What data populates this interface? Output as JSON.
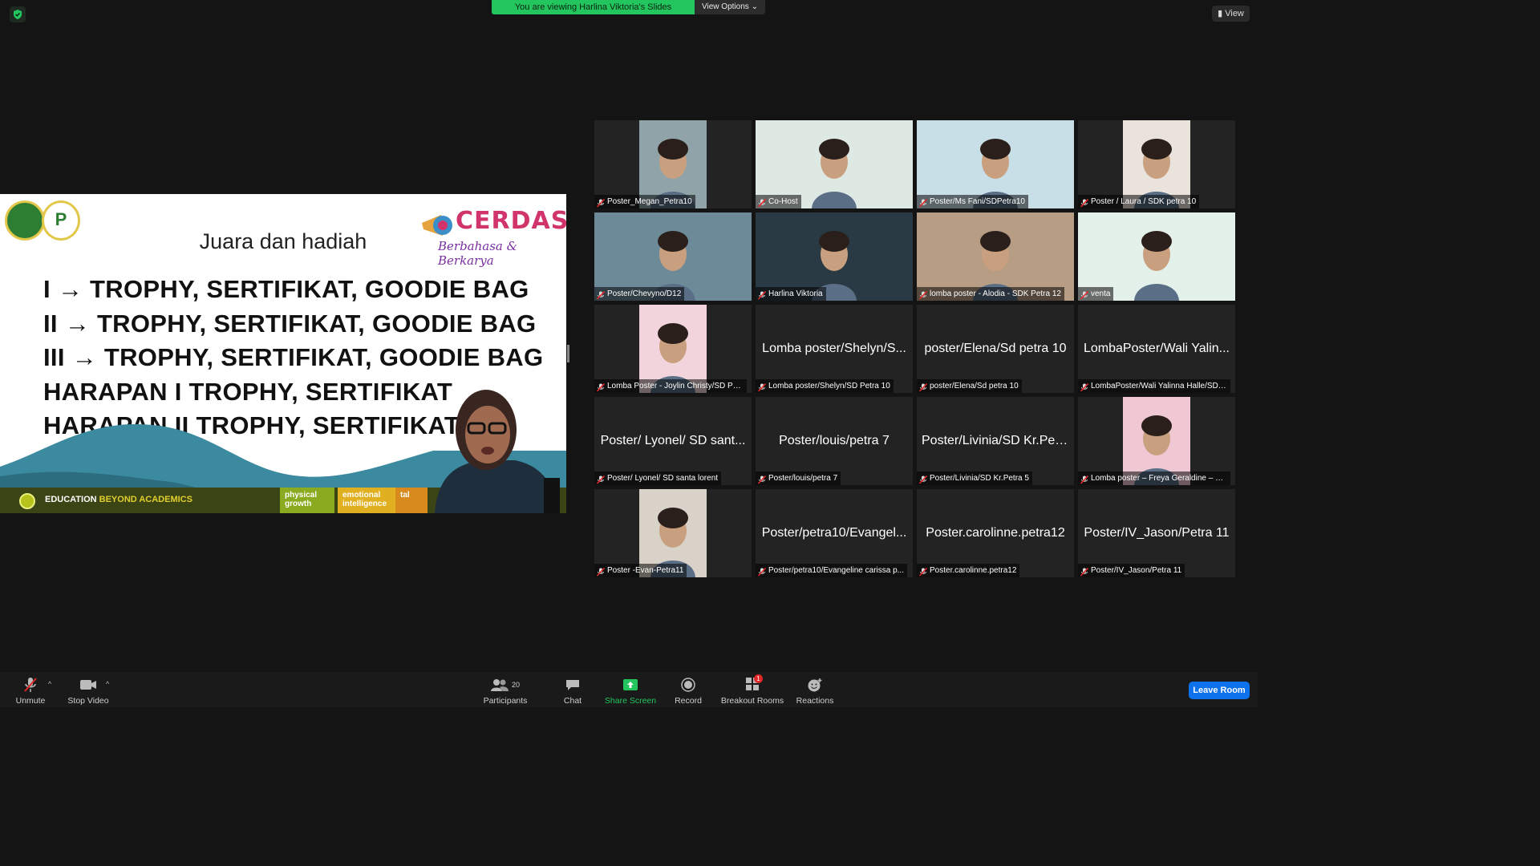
{
  "top": {
    "banner": "You are viewing Harlina Viktoria's Slides",
    "view_options": "View Options",
    "view_label": "View"
  },
  "slide": {
    "brand_title": "CERDAS",
    "brand_subtitle": "Berbahasa & Berkarya",
    "logo_b_text": "P",
    "heading": "Juara dan hadiah",
    "lines": [
      "I → TROPHY, SERTIFIKAT, GOODIE BAG",
      "II → TROPHY, SERTIFIKAT, GOODIE BAG",
      "III → TROPHY, SERTIFIKAT, GOODIE BAG",
      "HARAPAN I TROPHY, SERTIFIKAT",
      "HARAPAN II TROPHY, SERTIFIKAT"
    ],
    "footer_text": "EDUCATION",
    "footer_highlight": "BEYOND ACADEMICS",
    "chips": [
      "physical growth",
      "emotional intelligence",
      "tal"
    ]
  },
  "participants": [
    {
      "name": "Poster_Megan_Petra10",
      "big": "",
      "type": "video",
      "color": "#8fa3a8"
    },
    {
      "name": "Co-Host",
      "big": "",
      "type": "video",
      "color": "#dfe9e4"
    },
    {
      "name": "Poster/Ms Fani/SDPetra10",
      "big": "",
      "type": "video",
      "color": "#c9dfe8"
    },
    {
      "name": "Poster / Laura / SDK petra 10",
      "big": "",
      "type": "video",
      "color": "#e9e3dc"
    },
    {
      "name": "Poster/Chevyno/D12",
      "big": "",
      "type": "video",
      "color": "#6d8a99"
    },
    {
      "name": "Harlina Viktoria",
      "big": "",
      "type": "video",
      "color": "#2a3a44",
      "active": true
    },
    {
      "name": "lomba poster - Alodia - SDK Petra 12",
      "big": "",
      "type": "video",
      "color": "#b89d85"
    },
    {
      "name": "venta",
      "big": "",
      "type": "video",
      "color": "#e4f0ea"
    },
    {
      "name": "Lomba Poster - Joylin Christy/SD Pe...",
      "big": "",
      "type": "video",
      "color": "#f2d4dc"
    },
    {
      "name": "Lomba poster/Shelyn/SD Petra 10",
      "big": "Lomba poster/Shelyn/S...",
      "type": "name"
    },
    {
      "name": "poster/Elena/Sd petra 10",
      "big": "poster/Elena/Sd petra 10",
      "type": "name"
    },
    {
      "name": "LombaPoster/Wali Yalinna Halle/SDK...",
      "big": "LombaPoster/Wali Yalin...",
      "type": "name"
    },
    {
      "name": "Poster/ Lyonel/ SD santa lorent",
      "big": "Poster/ Lyonel/ SD sant...",
      "type": "name"
    },
    {
      "name": "Poster/louis/petra 7",
      "big": "Poster/louis/petra 7",
      "type": "name"
    },
    {
      "name": "Poster/Livinia/SD Kr.Petra 5",
      "big": "Poster/Livinia/SD Kr.Pet...",
      "type": "name"
    },
    {
      "name": "Lomba poster – Freya Geraldine – S...",
      "big": "",
      "type": "video",
      "color": "#f0c8d4"
    },
    {
      "name": "Poster -Evan-Petra11",
      "big": "",
      "type": "video",
      "color": "#d9d2c8"
    },
    {
      "name": "Poster/petra10/Evangeline carissa p...",
      "big": "Poster/petra10/Evangel...",
      "type": "name"
    },
    {
      "name": "Poster.carolinne.petra12",
      "big": "Poster.carolinne.petra12",
      "type": "name"
    },
    {
      "name": "Poster/IV_Jason/Petra 11",
      "big": "Poster/IV_Jason/Petra 11",
      "type": "name"
    }
  ],
  "toolbar": {
    "unmute": "Unmute",
    "stop_video": "Stop Video",
    "participants": "Participants",
    "participants_count": "20",
    "chat": "Chat",
    "share_screen": "Share Screen",
    "record": "Record",
    "breakout_rooms": "Breakout Rooms",
    "breakout_badge": "1",
    "reactions": "Reactions",
    "leave": "Leave Room"
  },
  "colors": {
    "accent_green": "#22c55e",
    "leave_blue": "#0e72ed",
    "active_speaker": "#e8e37a",
    "muted_red": "#e02828"
  }
}
